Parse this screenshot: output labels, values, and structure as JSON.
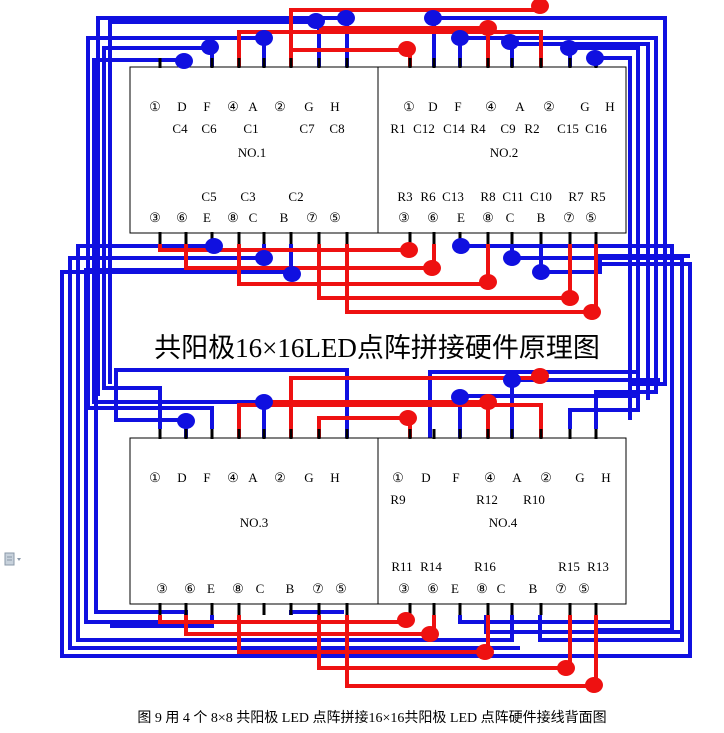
{
  "title": "共阳极16×16LED点阵拼接硬件原理图",
  "caption": "图 9   用 4 个 8×8 共阳极 LED 点阵拼接16×16共阳极 LED 点阵硬件接线背面图",
  "colors": {
    "blue": "#1010e0",
    "red": "#ee1111",
    "border": "#000000"
  },
  "modules": [
    {
      "name": "NO.1",
      "top_pins": [
        "①",
        "D",
        "F",
        "④",
        "A",
        "②",
        "G",
        "H"
      ],
      "top_sub": [
        "C4",
        "C6",
        "C1",
        "C7",
        "C8"
      ],
      "bot_sub": [
        "C5",
        "C3",
        "C2"
      ],
      "bot_pins": [
        "③",
        "⑥",
        "E",
        "⑧",
        "C",
        "B",
        "⑦",
        "⑤"
      ]
    },
    {
      "name": "NO.2",
      "top_pins": [
        "①",
        "D",
        "F",
        "④",
        "A",
        "②",
        "G",
        "H"
      ],
      "top_sub": [
        "R1",
        "C12",
        "C14",
        "R4",
        "C9",
        "R2",
        "C15",
        "C16"
      ],
      "bot_sub": [
        "R3",
        "R6",
        "C13",
        "R8",
        "C11",
        "C10",
        "R7",
        "R5"
      ],
      "bot_pins": [
        "③",
        "⑥",
        "E",
        "⑧",
        "C",
        "B",
        "⑦",
        "⑤"
      ]
    },
    {
      "name": "NO.3",
      "top_pins": [
        "①",
        "D",
        "F",
        "④",
        "A",
        "②",
        "G",
        "H"
      ],
      "top_sub": [],
      "bot_sub": [],
      "bot_pins": [
        "③",
        "⑥",
        "E",
        "⑧",
        "C",
        "B",
        "⑦",
        "⑤"
      ]
    },
    {
      "name": "NO.4",
      "top_pins": [
        "①",
        "D",
        "F",
        "④",
        "A",
        "②",
        "G",
        "H"
      ],
      "top_sub": [
        "R9",
        "R12",
        "R10"
      ],
      "bot_sub": [
        "R11",
        "R14",
        "R16",
        "R15",
        "R13"
      ],
      "bot_pins": [
        "③",
        "⑥",
        "E",
        "⑧",
        "C",
        "B",
        "⑦",
        "⑤"
      ]
    }
  ]
}
